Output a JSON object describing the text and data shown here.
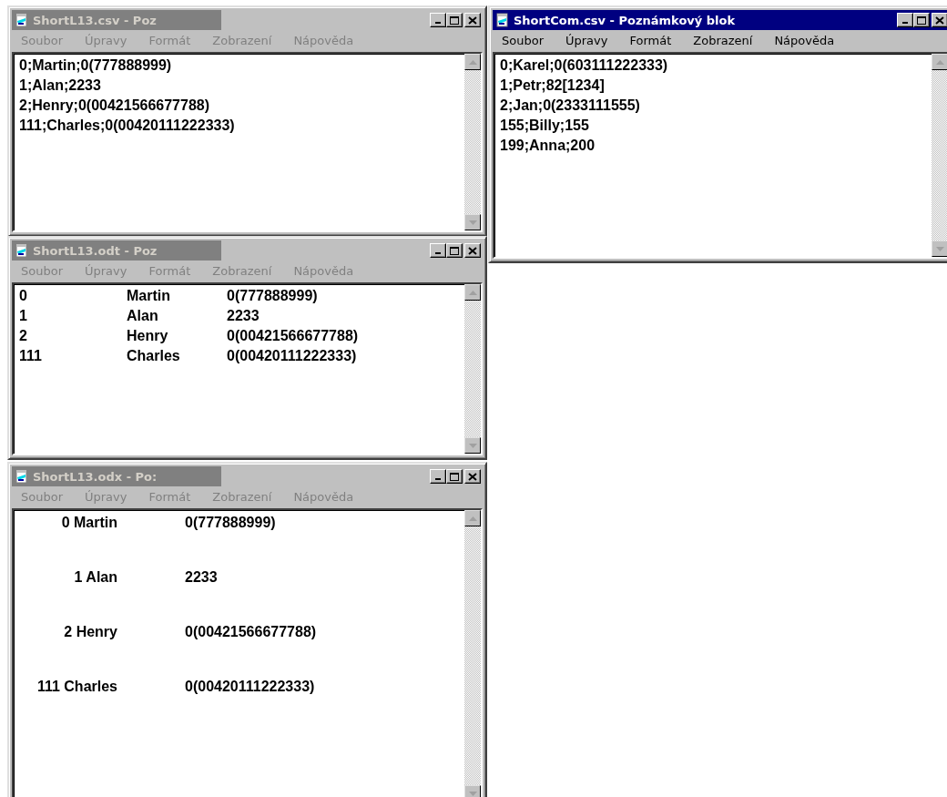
{
  "windows": [
    {
      "title": "ShortL13.csv - Poz",
      "active": false,
      "menu": [
        "Soubor",
        "Úpravy",
        "Formát",
        "Zobrazení",
        "Nápověda"
      ],
      "content": {
        "kind": "plain",
        "lines": [
          "0;Martin;0(777888999)",
          "1;Alan;2233",
          "2;Henry;0(00421566677788)",
          "111;Charles;0(00420111222333)"
        ]
      }
    },
    {
      "title": "ShortCom.csv - Poznámkový blok",
      "active": true,
      "menu": [
        "Soubor",
        "Úpravy",
        "Formát",
        "Zobrazení",
        "Nápověda"
      ],
      "content": {
        "kind": "plain",
        "lines": [
          "0;Karel;0(603111222333)",
          "1;Petr;82[1234]",
          "2;Jan;0(2333111555)",
          "155;Billy;155",
          "199;Anna;200"
        ]
      }
    },
    {
      "title": "ShortL13.odt - Poz",
      "active": false,
      "menu": [
        "Soubor",
        "Úpravy",
        "Formát",
        "Zobrazení",
        "Nápověda"
      ],
      "content": {
        "kind": "columns",
        "lines": [
          [
            "0",
            "Martin",
            "0(777888999)"
          ],
          [
            "1",
            "Alan",
            "2233"
          ],
          [
            "2",
            "Henry",
            "0(00421566677788)"
          ],
          [
            "111",
            "Charles",
            "0(00420111222333)"
          ]
        ]
      }
    },
    {
      "title": "ShortL13.odx - Po:",
      "active": false,
      "menu": [
        "Soubor",
        "Úpravy",
        "Formát",
        "Zobrazení",
        "Nápověda"
      ],
      "content": {
        "kind": "spaced",
        "lines": [
          [
            "0 Martin",
            "0(777888999)"
          ],
          [
            "1 Alan",
            "2233"
          ],
          [
            "2 Henry",
            "0(00421566677788)"
          ],
          [
            "111 Charles",
            "0(00420111222333)"
          ]
        ]
      }
    }
  ]
}
